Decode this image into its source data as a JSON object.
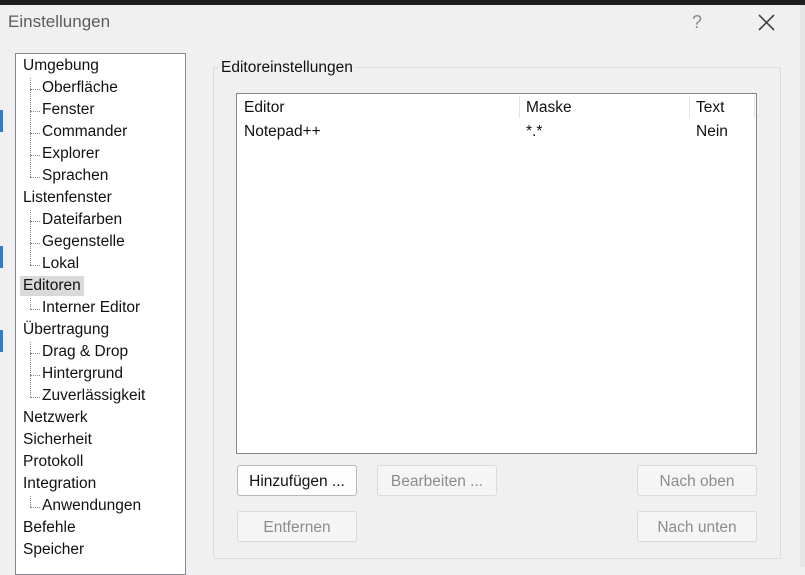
{
  "window": {
    "title": "Einstellungen",
    "help_label": "?",
    "close_icon": "close-icon"
  },
  "tree": {
    "items": [
      {
        "label": "Umgebung",
        "level": 0,
        "selected": false
      },
      {
        "label": "Oberfläche",
        "level": 1,
        "selected": false
      },
      {
        "label": "Fenster",
        "level": 1,
        "selected": false
      },
      {
        "label": "Commander",
        "level": 1,
        "selected": false
      },
      {
        "label": "Explorer",
        "level": 1,
        "selected": false
      },
      {
        "label": "Sprachen",
        "level": 1,
        "selected": false
      },
      {
        "label": "Listenfenster",
        "level": 0,
        "selected": false
      },
      {
        "label": "Dateifarben",
        "level": 1,
        "selected": false
      },
      {
        "label": "Gegenstelle",
        "level": 1,
        "selected": false
      },
      {
        "label": "Lokal",
        "level": 1,
        "selected": false
      },
      {
        "label": "Editoren",
        "level": 0,
        "selected": true
      },
      {
        "label": "Interner Editor",
        "level": 1,
        "selected": false
      },
      {
        "label": "Übertragung",
        "level": 0,
        "selected": false
      },
      {
        "label": "Drag & Drop",
        "level": 1,
        "selected": false
      },
      {
        "label": "Hintergrund",
        "level": 1,
        "selected": false
      },
      {
        "label": "Zuverlässigkeit",
        "level": 1,
        "selected": false
      },
      {
        "label": "Netzwerk",
        "level": 0,
        "selected": false
      },
      {
        "label": "Sicherheit",
        "level": 0,
        "selected": false
      },
      {
        "label": "Protokoll",
        "level": 0,
        "selected": false
      },
      {
        "label": "Integration",
        "level": 0,
        "selected": false
      },
      {
        "label": "Anwendungen",
        "level": 1,
        "selected": false
      },
      {
        "label": "Befehle",
        "level": 0,
        "selected": false
      },
      {
        "label": "Speicher",
        "level": 0,
        "selected": false
      }
    ]
  },
  "editor_settings": {
    "group_title": "Editoreinstellungen",
    "columns": [
      "Editor",
      "Maske",
      "Text"
    ],
    "rows": [
      [
        "Notepad++",
        "*.*",
        "Nein"
      ]
    ],
    "buttons": {
      "add": "Hinzufügen ...",
      "edit": "Bearbeiten ...",
      "up": "Nach oben",
      "remove": "Entfernen",
      "down": "Nach unten"
    }
  }
}
